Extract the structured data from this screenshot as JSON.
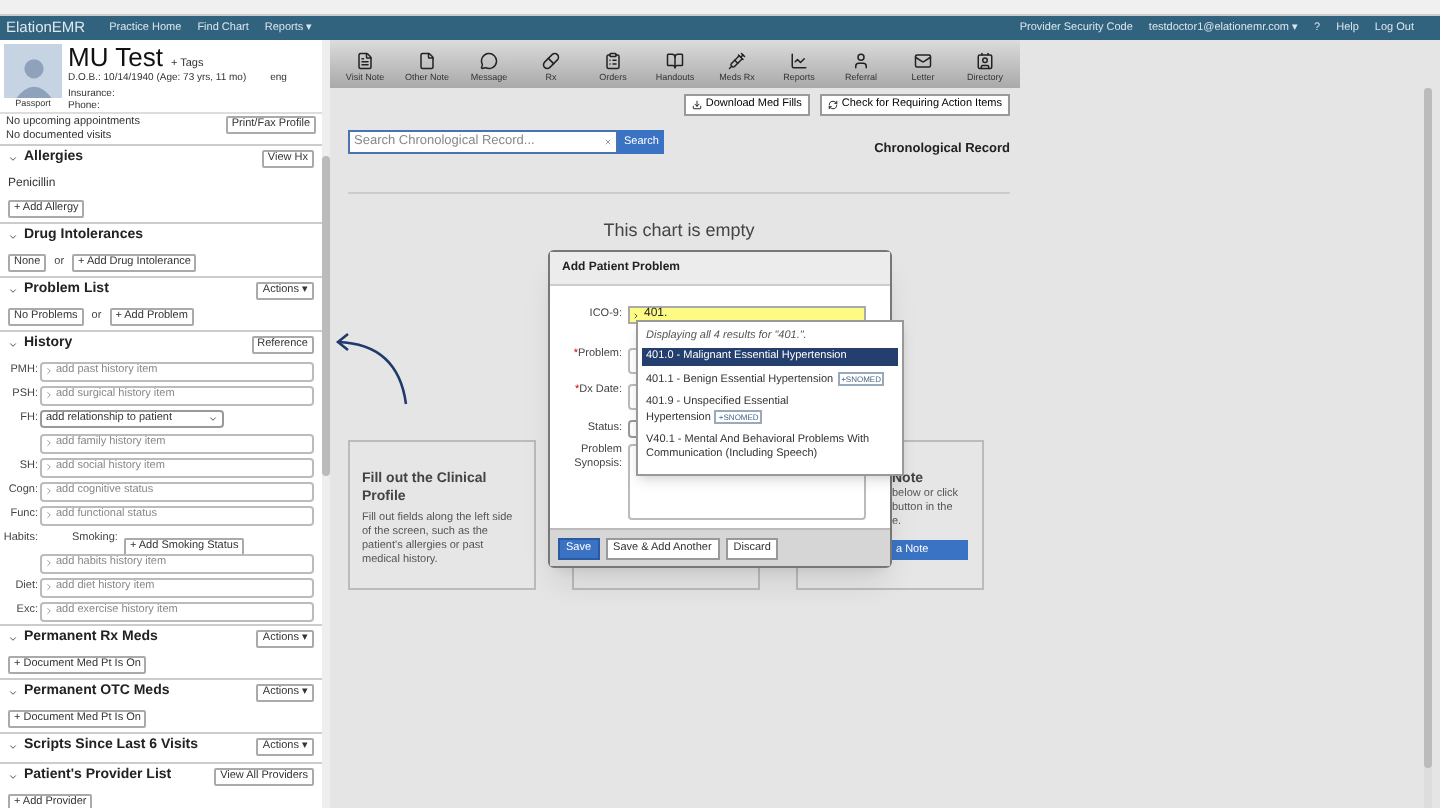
{
  "nav": {
    "logo": "ElationEMR",
    "links": [
      "Practice Home",
      "Find Chart",
      "Reports ▾"
    ],
    "right": [
      "Provider Security Code",
      "testdoctor1@elationemr.com ▾",
      "?",
      "Help",
      "Log Out"
    ]
  },
  "patient": {
    "badge": "Passport",
    "name": "MU Test",
    "tags": "+ Tags",
    "dob": "D.O.B.: 10/14/1940 (Age: 73 yrs, 11 mo)",
    "lang": "eng",
    "insurance": "Insurance:",
    "phone": "Phone:",
    "appointments": "No upcoming appointments",
    "visits": "No documented visits",
    "print": "Print/Fax Profile"
  },
  "sections": [
    {
      "title": "Allergies",
      "action": "View Hx",
      "lines": [
        {
          "kind": "text",
          "text": "Penicillin"
        },
        {
          "kind": "button",
          "text": "+ Add Allergy"
        }
      ]
    },
    {
      "title": "Drug Intolerances",
      "lines": [
        {
          "kind": "choice",
          "left": "None",
          "or": "or",
          "right": "+ Add Drug Intolerance"
        }
      ]
    },
    {
      "title": "Problem List",
      "action": "Actions ▾",
      "lines": [
        {
          "kind": "choice",
          "left": "No Problems",
          "or": "or",
          "right": "+ Add Problem"
        }
      ]
    },
    {
      "title": "History",
      "action": "Reference",
      "lines": [
        {
          "kind": "field",
          "label": "PMH:",
          "placeholder": "add past history item"
        },
        {
          "kind": "field",
          "label": "PSH:",
          "placeholder": "add surgical history item"
        },
        {
          "kind": "select",
          "label": "FH:",
          "value": "add relationship to patient"
        },
        {
          "kind": "field",
          "placeholder": "add family history item"
        },
        {
          "kind": "field",
          "label": "SH:",
          "placeholder": "add social history item"
        },
        {
          "kind": "field",
          "label": "Cogn:",
          "placeholder": "add cognitive status"
        },
        {
          "kind": "field",
          "label": "Func:",
          "placeholder": "add functional status"
        },
        {
          "kind": "smoking",
          "label": "Habits:",
          "sublabel": "Smoking:",
          "button": "+ Add Smoking Status"
        },
        {
          "kind": "field",
          "placeholder": "add habits history item"
        },
        {
          "kind": "field",
          "label": "Diet:",
          "placeholder": "add diet history item"
        },
        {
          "kind": "field",
          "label": "Exc:",
          "placeholder": "add exercise history item"
        }
      ]
    },
    {
      "title": "Permanent Rx Meds",
      "action": "Actions ▾",
      "lines": [
        {
          "kind": "button",
          "text": "+ Document Med Pt Is On"
        }
      ]
    },
    {
      "title": "Permanent OTC Meds",
      "action": "Actions ▾",
      "lines": [
        {
          "kind": "button",
          "text": "+ Document Med Pt Is On"
        }
      ]
    },
    {
      "title": "Scripts Since Last 6 Visits",
      "action": "Actions ▾"
    },
    {
      "title": "Patient's Provider List",
      "action": "View All Providers",
      "lines": [
        {
          "kind": "button",
          "text": "+ Add Provider"
        }
      ]
    }
  ],
  "toolbar": [
    {
      "kind": "note",
      "label": "Visit Note"
    },
    {
      "kind": "page",
      "label": "Other Note"
    },
    {
      "kind": "message",
      "label": "Message"
    },
    {
      "kind": "rx",
      "label": "Rx"
    },
    {
      "kind": "orders",
      "label": "Orders"
    },
    {
      "kind": "handouts",
      "label": "Handouts"
    },
    {
      "kind": "meds",
      "label": "Meds Rx"
    },
    {
      "kind": "reports",
      "label": "Reports"
    },
    {
      "kind": "referral",
      "label": "Referral"
    },
    {
      "kind": "letter",
      "label": "Letter"
    },
    {
      "kind": "directory",
      "label": "Directory"
    }
  ],
  "actions": [
    "Download Med Fills",
    "Check for Requiring Action Items"
  ],
  "search": {
    "placeholder": "Search Chronological Record...",
    "button": "Search"
  },
  "record_title": "Chronological Record",
  "empty": "This chart is empty",
  "cards": [
    {
      "kind": "info",
      "title": "Fill out the Clinical Profile",
      "text": "Fill out fields along the left side of the screen, such as the patient's allergies or past medical history."
    },
    {
      "kind": "covered"
    },
    {
      "kind": "partial",
      "title": "Note",
      "lines": [
        "below or click",
        "button in the",
        "e."
      ],
      "button": "a Note"
    }
  ],
  "dialog": {
    "title": "Add Patient Problem",
    "fields": [
      {
        "kind": "code",
        "label": "ICO-9:",
        "value": "401."
      },
      {
        "kind": "text",
        "label": "*Problem:"
      },
      {
        "kind": "text",
        "label": "*Dx Date:"
      },
      {
        "kind": "select",
        "label": "Status:"
      },
      {
        "kind": "area",
        "label": "Problem Synopsis:"
      }
    ],
    "buttons": [
      "Save",
      "Save & Add Another",
      "Discard"
    ]
  },
  "results": {
    "header": "Displaying all 4 results for \"401.\".",
    "items": [
      {
        "text": "401.0 - Malignant Essential Hypertension",
        "selected": true
      },
      {
        "text": "401.1 - Benign Essential Hypertension",
        "tag": "+SNOMED",
        "selected": false
      },
      {
        "text": "401.9 - Unspecified Essential Hypertension",
        "tag": "+SNOMED",
        "selected": false
      },
      {
        "text": "V40.1 - Mental And Behavioral Problems With Communication (Including Speech)",
        "selected": false
      }
    ]
  }
}
